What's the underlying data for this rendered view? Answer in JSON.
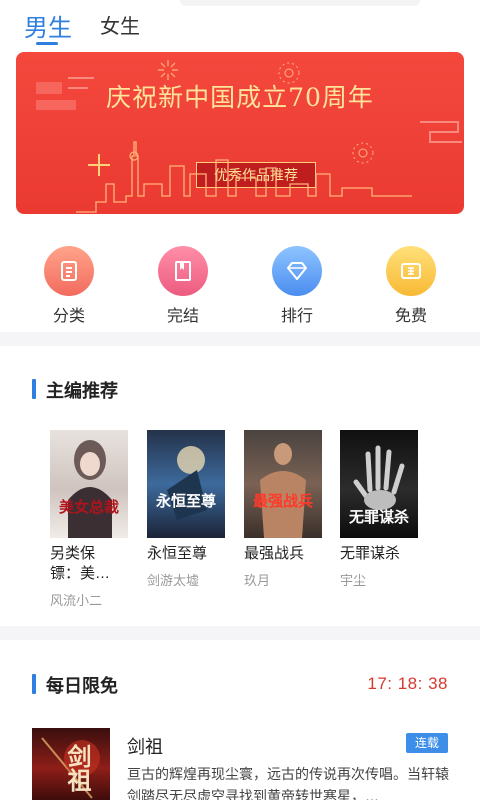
{
  "tabs": [
    {
      "label": "男生",
      "active": true
    },
    {
      "label": "女生",
      "active": false
    }
  ],
  "banner": {
    "title": "庆祝新中国成立70周年",
    "subtitle": "优秀作品推荐",
    "slide_count": 3,
    "active_slide": 1,
    "colors": {
      "background": "#ef4136",
      "text": "#ffe39a"
    }
  },
  "categories": [
    {
      "label": "分类",
      "icon": "clipboard-icon",
      "color": "#f26b5f"
    },
    {
      "label": "完结",
      "icon": "book-icon",
      "color": "#ec5b80"
    },
    {
      "label": "排行",
      "icon": "diamond-icon",
      "color": "#4b8df0"
    },
    {
      "label": "免费",
      "icon": "ticket-icon",
      "color": "#f8b934"
    }
  ],
  "editor_picks": {
    "title": "主编推荐",
    "books": [
      {
        "title": "另类保镖：美…",
        "author": "风流小二",
        "cover_text": "美女总裁"
      },
      {
        "title": "永恒至尊",
        "author": "剑游太墟",
        "cover_text": "永恒至尊"
      },
      {
        "title": "最强战兵",
        "author": "玖月",
        "cover_text": "最强战兵"
      },
      {
        "title": "无罪谋杀",
        "author": "宇尘",
        "cover_text": "无罪谋杀"
      }
    ]
  },
  "daily_free": {
    "title": "每日限免",
    "countdown": "17: 18: 38",
    "book": {
      "title": "剑祖",
      "status": "连载",
      "cover_text": "剑祖",
      "description": "亘古的辉煌再现尘寰，远古的传说再次传唱。当轩辕剑踏尽无尽虚空寻找到黄帝转世寒星，…"
    }
  },
  "accent_color": "#2f7fe0"
}
